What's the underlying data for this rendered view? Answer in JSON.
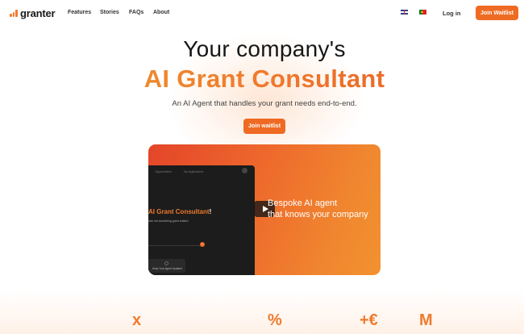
{
  "nav": {
    "logo_text": "granter",
    "links": [
      "Features",
      "Stories",
      "FAQs",
      "About"
    ],
    "login_label": "Log in",
    "cta_label": "Join Waitlist"
  },
  "hero": {
    "title": "Your company's",
    "accent": "AI Grant Consultant",
    "subtitle": "An AI Agent that handles your grant needs end-to-end.",
    "cta_label": "Join waitlist"
  },
  "video": {
    "tab_left": "Opportunities",
    "tab_right": "My Applications",
    "inner_title": "AI Grant Consultant",
    "inner_title_tail": "!",
    "inner_text": "Ask me something grant related",
    "inner_card_text": "Keep Your Agent Updated",
    "tagline_line1": "Bespoke AI agent",
    "tagline_line2": "that knows your company"
  },
  "stats": [
    "x",
    "%",
    "+€",
    "M"
  ],
  "colors": {
    "accent": "#ef6b23",
    "accent_light": "#f0872f",
    "accent_deep": "#e4452a"
  }
}
